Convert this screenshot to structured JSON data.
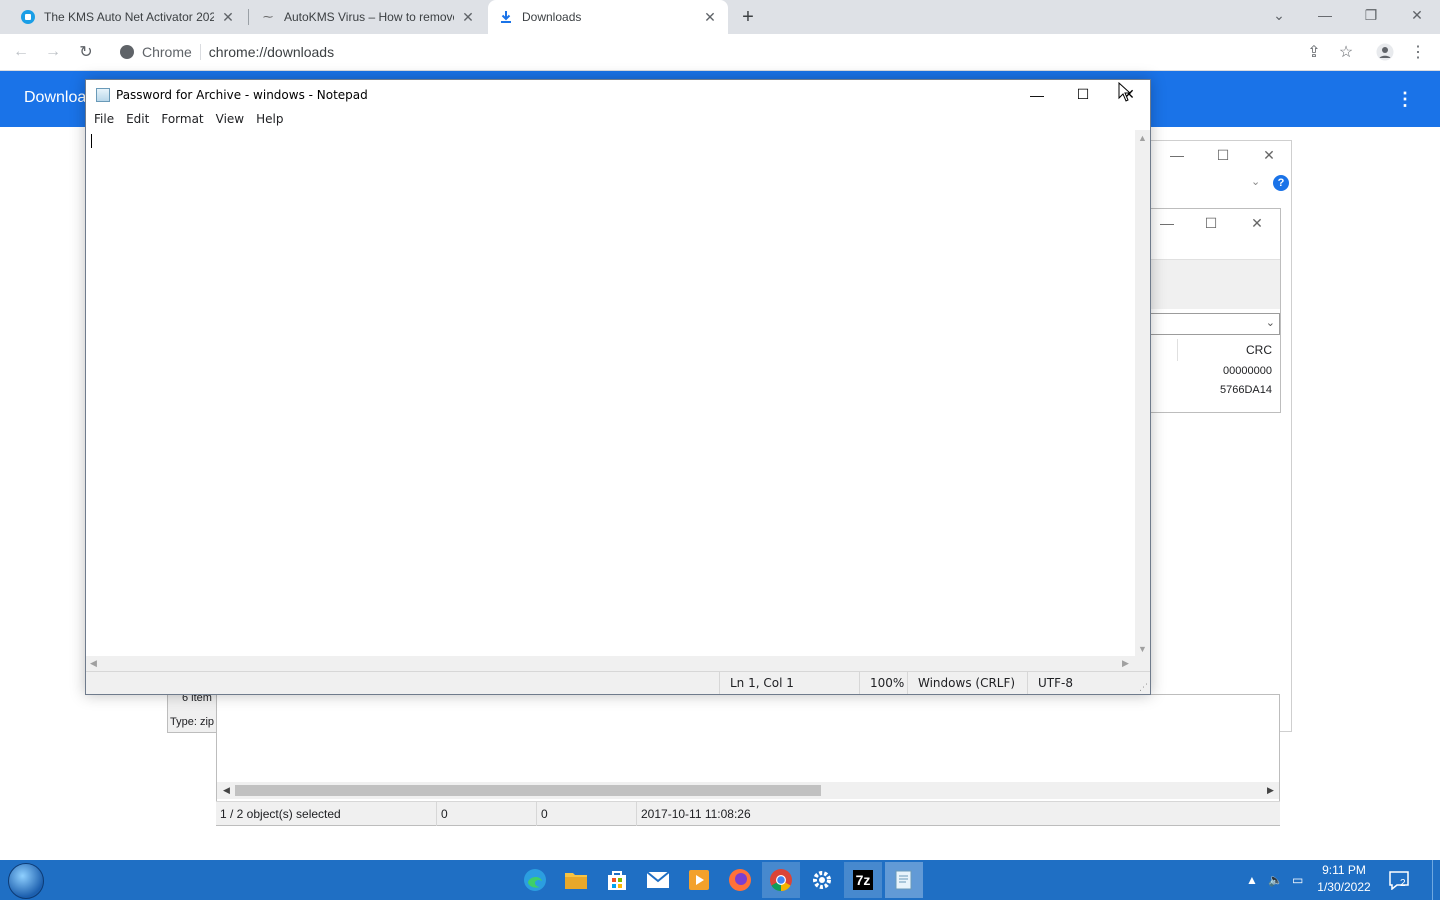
{
  "browser": {
    "tabs": [
      {
        "title": "The KMS Auto Net Activator 202",
        "icon": "globe-icon",
        "active": false
      },
      {
        "title": "AutoKMS Virus – How to remove",
        "icon": "site-icon",
        "active": false
      },
      {
        "title": "Downloads",
        "icon": "download-icon",
        "active": true
      }
    ],
    "new_tab": "+",
    "omnibox": {
      "site_label": "Chrome",
      "url": "chrome://downloads"
    },
    "page_title": "Downloa"
  },
  "notepad": {
    "title": "Password for Archive - windows - Notepad",
    "menu": [
      "File",
      "Edit",
      "Format",
      "View",
      "Help"
    ],
    "content": "",
    "status": {
      "position": "Ln 1, Col 1",
      "zoom": "100%",
      "line_endings": "Windows (CRLF)",
      "encoding": "UTF-8"
    }
  },
  "archive_window": {
    "column_header": "CRC",
    "crc_values": [
      "00000000",
      "5766DA14"
    ],
    "left_info": {
      "items": "6 item",
      "type": "Type: zip"
    },
    "status": {
      "selection": "1 / 2 object(s) selected",
      "size": "0",
      "packed": "0",
      "modified": "2017-10-11 11:08:26"
    }
  },
  "taskbar": {
    "time": "9:11 PM",
    "date": "1/30/2022",
    "notification_count": "2",
    "apps": [
      "edge-icon",
      "file-explorer-icon",
      "store-icon",
      "mail-icon",
      "media-player-icon",
      "firefox-icon",
      "chrome-icon",
      "settings-icon",
      "7zip-icon",
      "notepad-icon"
    ],
    "seven_zip_label": "7z"
  },
  "colors": {
    "chrome_accent": "#1a73e8",
    "taskbar": "#1f6fc4",
    "tab_strip": "#dee1e6"
  }
}
